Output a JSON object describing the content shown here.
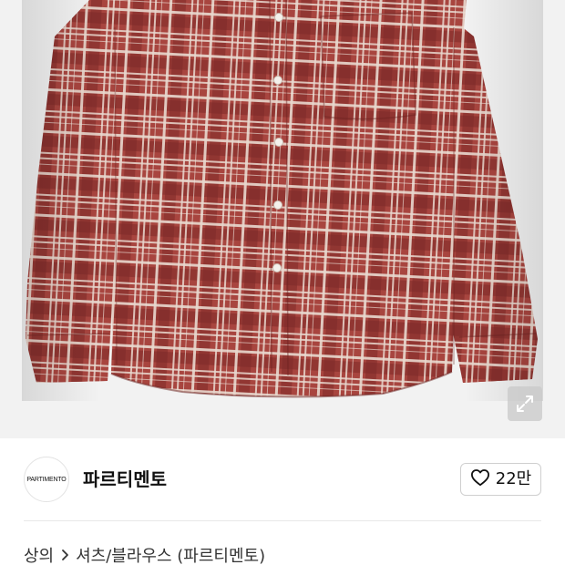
{
  "product": {
    "shirt_colors": {
      "base": "#a8453f",
      "dark": "#7e2a28",
      "light": "#e9d9cf",
      "button": "#f4f1ec"
    },
    "background_color": "#f2f2f2",
    "expand_icon": "expand-arrows-icon"
  },
  "brand": {
    "logo_text": "PARTIMENTO",
    "name": "파르티멘토",
    "like_icon": "heart-outline-icon",
    "like_count": "22만"
  },
  "breadcrumb": {
    "category": "상의",
    "separator_icon": "chevron-right-icon",
    "subcategory": "셔츠/블라우스 (파르티멘토)"
  }
}
